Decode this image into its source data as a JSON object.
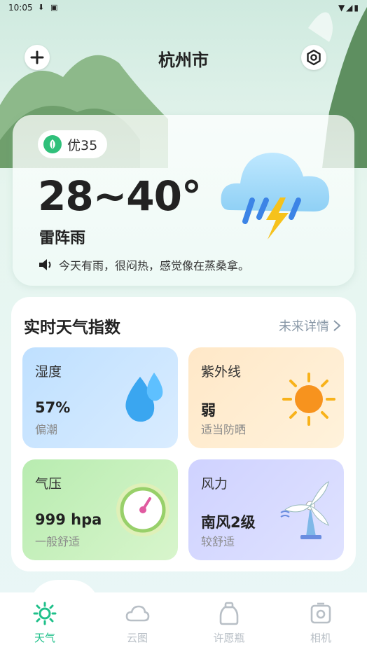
{
  "status_bar": {
    "time": "10:05"
  },
  "header": {
    "city": "杭州市"
  },
  "hero": {
    "aqi": "优35",
    "temperature": "28~40°",
    "condition": "雷阵雨",
    "tip": "今天有雨，很闷热，感觉像在蒸桑拿。"
  },
  "index_panel": {
    "title": "实时天气指数",
    "more": "未来详情",
    "cards": [
      {
        "label": "湿度",
        "value": "57%",
        "desc": "偏潮"
      },
      {
        "label": "紫外线",
        "value": "弱",
        "desc": "适当防晒"
      },
      {
        "label": "气压",
        "value": "999 hpa",
        "desc": "一般舒适"
      },
      {
        "label": "风力",
        "value": "南风2级",
        "desc": "较舒适"
      }
    ]
  },
  "tabs": [
    {
      "label": "天气",
      "active": true
    },
    {
      "label": "云图",
      "active": false
    },
    {
      "label": "许愿瓶",
      "active": false
    },
    {
      "label": "相机",
      "active": false
    }
  ],
  "colors": {
    "accent": "#1fc08a",
    "inactive": "#b8bfc6"
  }
}
